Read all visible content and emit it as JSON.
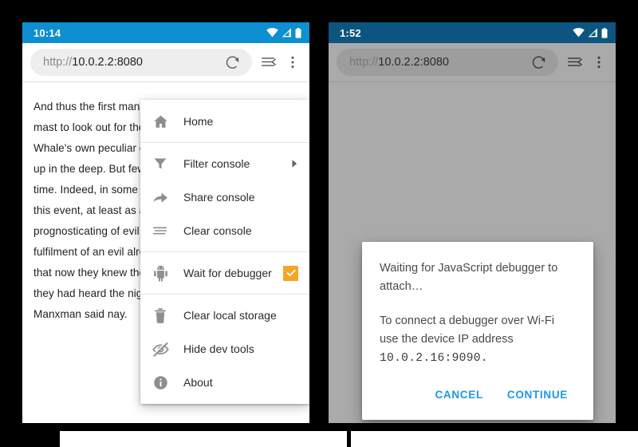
{
  "phone_left": {
    "status": {
      "time": "10:14",
      "icons": [
        "wifi-icon",
        "signal-icon",
        "battery-icon"
      ]
    },
    "toolbar": {
      "url_scheme": "http://",
      "url_host": "10.0.2.2:8080",
      "reload_icon": "reload-icon",
      "tabs_icon": "reading-list-icon",
      "overflow_icon": "overflow-menu-icon"
    },
    "article": "And thus the first man of the Pequod that mounted the mast to look out for the White Whale, on the White Whale's own peculiar ground; that man was swallowed up in the deep. But few, perhaps, thought of that at the time. Indeed, in some sort, they were not grieved at this event, at least as a portent; for they took it to be a prognosticating of evil in the future, but as the fulfilment of an evil already presaged. They declared that now they knew the reason of those wild shrieks they had heard the night before. But again the old Manxman said nay."
  },
  "menu": {
    "items": [
      {
        "label": "Home",
        "icon": "home-icon",
        "type": "plain",
        "name": "menu-item-home"
      },
      {
        "label": "Filter console",
        "icon": "filter-icon",
        "type": "submenu",
        "name": "menu-item-filter-console"
      },
      {
        "label": "Share console",
        "icon": "share-icon",
        "type": "plain",
        "name": "menu-item-share-console"
      },
      {
        "label": "Clear console",
        "icon": "clear-icon",
        "type": "plain",
        "name": "menu-item-clear-console"
      },
      {
        "label": "Wait for debugger",
        "icon": "android-icon",
        "type": "checkbox",
        "checked": true,
        "name": "menu-item-wait-for-debugger"
      },
      {
        "label": "Clear local storage",
        "icon": "trash-icon",
        "type": "plain",
        "name": "menu-item-clear-local-storage"
      },
      {
        "label": "Hide dev tools",
        "icon": "eye-off-icon",
        "type": "plain",
        "name": "menu-item-hide-dev-tools"
      },
      {
        "label": "About",
        "icon": "info-icon",
        "type": "plain",
        "name": "menu-item-about"
      }
    ],
    "checkbox_color": "#f5a623",
    "separator_after": [
      0,
      4
    ]
  },
  "phone_right": {
    "status": {
      "time": "1:52",
      "icons": [
        "wifi-icon",
        "signal-icon",
        "battery-icon"
      ]
    },
    "toolbar": {
      "url_scheme": "http://",
      "url_host": "10.0.2.2:8080",
      "reload_icon": "reload-icon",
      "tabs_icon": "reading-list-icon",
      "overflow_icon": "overflow-menu-icon"
    },
    "dialog": {
      "paragraph_1": "Waiting for JavaScript debugger to attach…",
      "paragraph_2_prefix": "To connect a debugger over Wi-Fi use the device IP address ",
      "address": "10.0.2.16:9090",
      "paragraph_2_suffix": ".",
      "cancel_label": "CANCEL",
      "continue_label": "CONTINUE",
      "button_color": "#1a9ae8"
    }
  },
  "colors": {
    "status_bar": "#0d8fd1",
    "status_bar_dim": "#0b5580",
    "scrim": "#aaaaaa",
    "accent_orange": "#f5a623",
    "link_blue": "#1a9ae8"
  }
}
